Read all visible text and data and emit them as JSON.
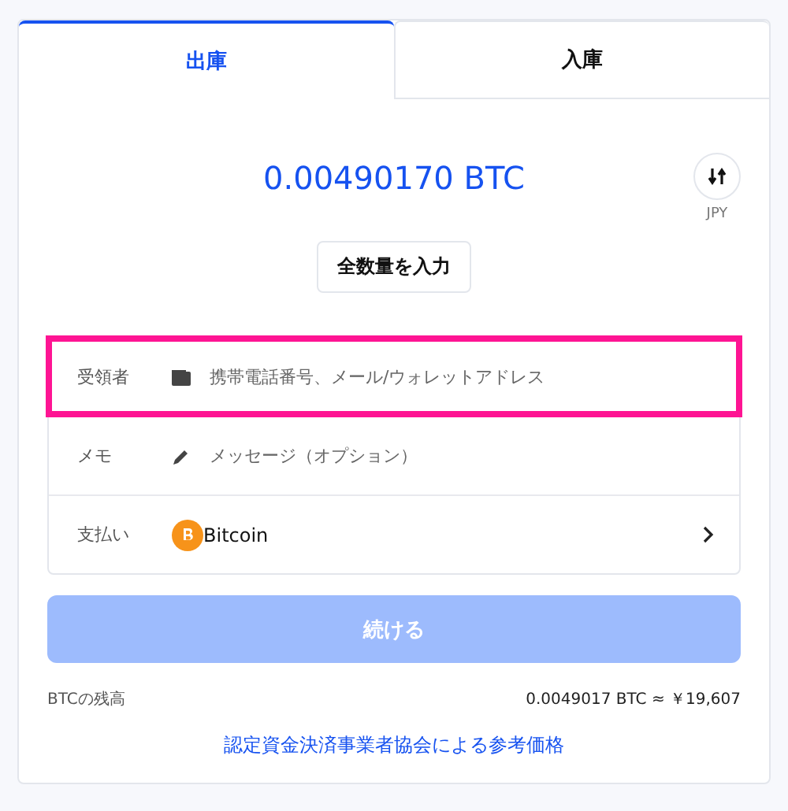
{
  "tabs": [
    {
      "label": "出庫",
      "selected": true
    },
    {
      "label": "入庫",
      "selected": false
    }
  ],
  "amount": "0.00490170 BTC",
  "currency_toggle": {
    "label": "JPY"
  },
  "max_button": "全数量を入力",
  "rows": [
    {
      "kind": "field",
      "label": "受領者",
      "placeholder": "携帯電話番号、メール/ウォレットアドレス",
      "highlighted": true
    },
    {
      "kind": "field",
      "label": "メモ",
      "placeholder": "メッセージ（オプション）",
      "highlighted": false
    },
    {
      "kind": "select",
      "label": "支払い",
      "value": "Bitcoin",
      "highlighted": false
    }
  ],
  "continue_button": {
    "label": "続ける",
    "disabled": true
  },
  "balance": {
    "label": "BTCの残高",
    "value": "0.0049017 BTC ≈ ￥19,607"
  },
  "reference_link": "認定資金決済事業者協会による参考価格"
}
